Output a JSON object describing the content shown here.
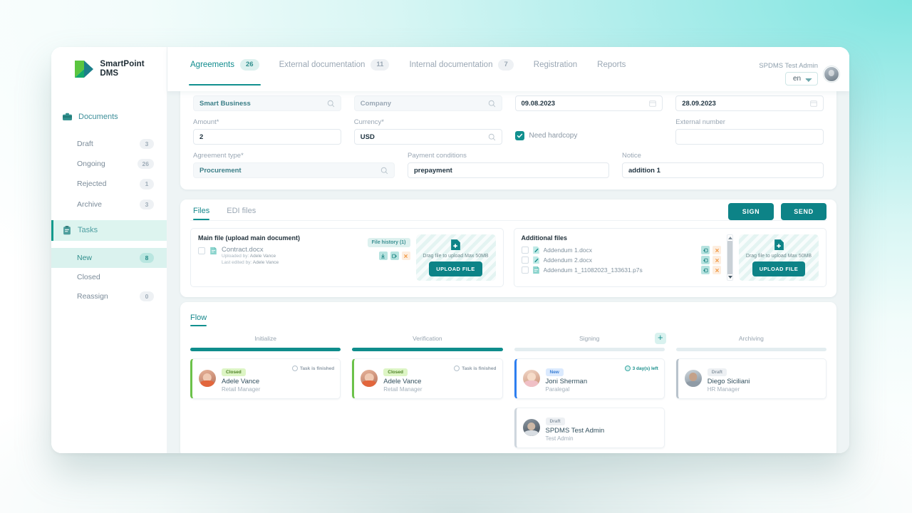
{
  "brand": {
    "line1": "SmartPoint",
    "line2": "DMS"
  },
  "topnav": {
    "tabs": [
      {
        "label": "Agreements",
        "count": "26",
        "active": true
      },
      {
        "label": "External documentation",
        "count": "11",
        "active": false
      },
      {
        "label": "Internal documentation",
        "count": "7",
        "active": false
      },
      {
        "label": "Registration",
        "count": "",
        "active": false
      },
      {
        "label": "Reports",
        "count": "",
        "active": false
      }
    ],
    "user_name": "SPDMS Test Admin",
    "language": "en",
    "language_options": [
      "en"
    ]
  },
  "sidebar": {
    "groups": [
      {
        "label": "Documents",
        "icon": "briefcase-icon",
        "active": false
      },
      {
        "label": "Tasks",
        "icon": "tasks-icon",
        "active": true
      }
    ],
    "documents_items": [
      {
        "label": "Draft",
        "count": "3",
        "active": false
      },
      {
        "label": "Ongoing",
        "count": "26",
        "active": false
      },
      {
        "label": "Rejected",
        "count": "1",
        "active": false
      },
      {
        "label": "Archive",
        "count": "3",
        "active": false
      }
    ],
    "tasks_items": [
      {
        "label": "New",
        "count": "8",
        "active": true
      },
      {
        "label": "Closed",
        "count": "",
        "active": false
      },
      {
        "label": "Reassign",
        "count": "0",
        "active": false
      }
    ]
  },
  "form": {
    "counterparty": {
      "value": "Smart Business",
      "icon": "search-icon"
    },
    "company": {
      "value": "Company",
      "icon": "search-icon"
    },
    "date_from": {
      "value": "09.08.2023",
      "icon": "calendar-icon"
    },
    "date_to": {
      "value": "28.09.2023",
      "icon": "calendar-icon"
    },
    "amount": {
      "label": "Amount*",
      "value": "2"
    },
    "currency": {
      "label": "Currency*",
      "value": "USD",
      "icon": "search-icon"
    },
    "need_hardcopy": {
      "label": "Need hardcopy",
      "checked": true
    },
    "external_number": {
      "label": "External number",
      "value": ""
    },
    "agreement_type": {
      "label": "Agreement type*",
      "value": "Procurement",
      "icon": "search-icon"
    },
    "payment_conditions": {
      "label": "Payment conditions",
      "value": "prepayment"
    },
    "notice": {
      "label": "Notice",
      "value": "addition 1"
    }
  },
  "files": {
    "tabs": [
      {
        "label": "Files",
        "active": true
      },
      {
        "label": "EDI files",
        "active": false
      }
    ],
    "sign_label": "SIGN",
    "send_label": "SEND",
    "main": {
      "title": "Main file (upload main document)",
      "history_label": "File history (1)",
      "name": "Contract.docx",
      "uploaded_by_label": "Uploaded by:",
      "uploaded_by": "Adele Vance",
      "last_edited_label": "Last edited by:",
      "last_edited_by": "Adele Vance",
      "actions": [
        "download-icon",
        "export-icon",
        "delete-icon"
      ]
    },
    "additional": {
      "title": "Additional files",
      "items": [
        {
          "name": "Addendum 1.docx",
          "icon": "word-doc-icon"
        },
        {
          "name": "Addendum 2.docx",
          "icon": "word-doc-icon"
        },
        {
          "name": "Addendum 1_11082023_133631.p7s",
          "icon": "signed-doc-icon"
        }
      ]
    },
    "dropzone": {
      "text": "Drag file to upload Max 50MB",
      "button": "UPLOAD FILE",
      "icon": "file-add-icon"
    }
  },
  "flow": {
    "title": "Flow",
    "add_step_icon": "plus-icon",
    "columns": [
      {
        "name": "Initialize",
        "progress": "done",
        "has_add": false,
        "items": [
          {
            "badge": "Closed",
            "badge_type": "closed",
            "name": "Adele Vance",
            "role": "Retail Manager",
            "status": "Task is finished",
            "status_type": "grey",
            "accent": "#6cc24a"
          }
        ]
      },
      {
        "name": "Verification",
        "progress": "done",
        "has_add": false,
        "items": [
          {
            "badge": "Closed",
            "badge_type": "closed",
            "name": "Adele Vance",
            "role": "Retail Manager",
            "status": "Task is finished",
            "status_type": "grey",
            "accent": "#6cc24a"
          }
        ]
      },
      {
        "name": "Signing",
        "progress": "pending",
        "has_add": true,
        "items": [
          {
            "badge": "New",
            "badge_type": "new",
            "name": "Joni Sherman",
            "role": "Paralegal",
            "status": "3 day(s) left",
            "status_type": "teal",
            "accent": "#2e7ff0"
          },
          {
            "badge": "Draft",
            "badge_type": "draft",
            "name": "SPDMS Test Admin",
            "role": "Test Admin",
            "status": "",
            "status_type": "grey",
            "accent": "#cfd7de"
          }
        ]
      },
      {
        "name": "Archiving",
        "progress": "pending",
        "has_add": false,
        "items": [
          {
            "badge": "Draft",
            "badge_type": "draft",
            "name": "Diego Siciliani",
            "role": "HR Manager",
            "status": "",
            "status_type": "grey",
            "accent": "#b9c3cc"
          }
        ]
      }
    ]
  },
  "colors": {
    "accent": "#0d8387",
    "accent_light": "#ddf1ef",
    "danger": "#f0933a",
    "success": "#6cc24a",
    "info": "#2e7ff0"
  }
}
